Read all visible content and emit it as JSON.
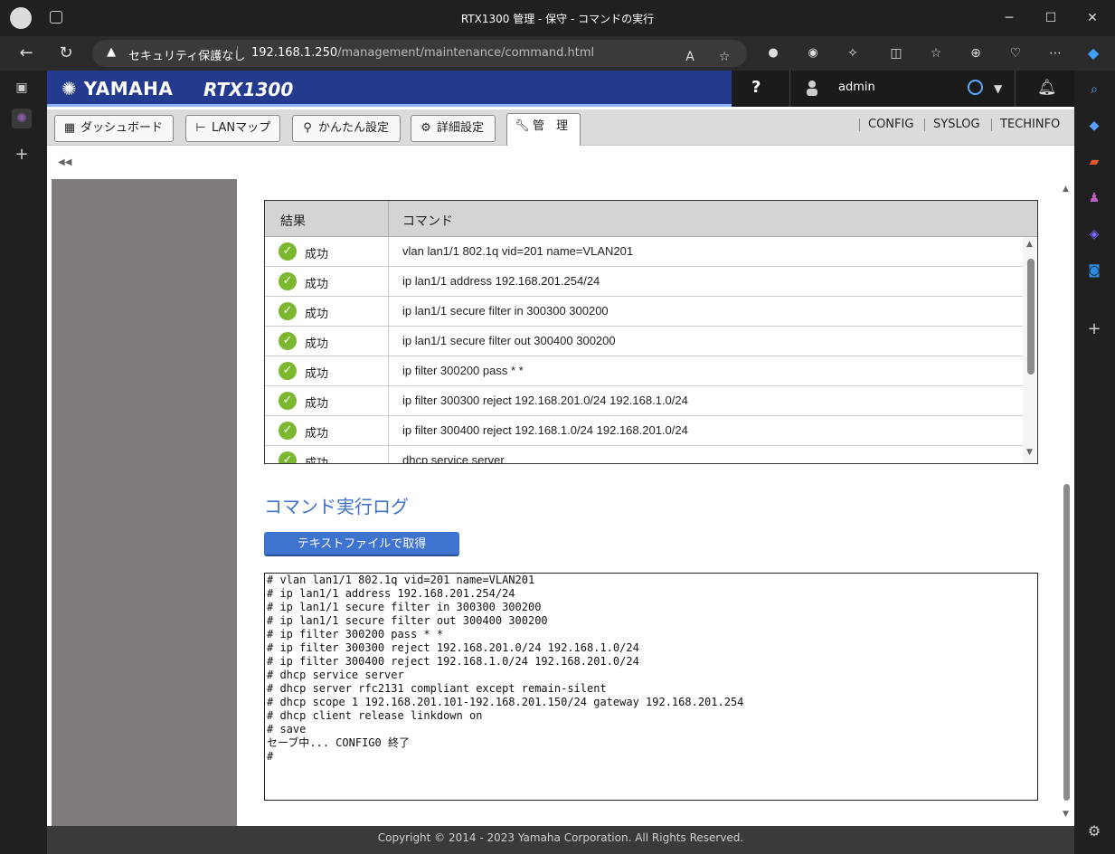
{
  "browser": {
    "title": "RTX1300 管理 - 保守 - コマンドの実行",
    "security_label": "セキュリティ保護なし",
    "url_host": "192.168.1.250",
    "url_path": "/management/maintenance/command.html"
  },
  "header": {
    "logo": "YAMAHA",
    "model": "RTX1300",
    "help": "?",
    "user": "admin"
  },
  "menu": {
    "items": [
      {
        "label": "ダッシュボード",
        "icon": "dashboard-icon"
      },
      {
        "label": "LANマップ",
        "icon": "lanmap-icon"
      },
      {
        "label": "かんたん設定",
        "icon": "wand-icon"
      },
      {
        "label": "詳細設定",
        "icon": "gear-icon"
      },
      {
        "label": "管　理",
        "icon": "wrench-icon"
      }
    ],
    "links": [
      "CONFIG",
      "SYSLOG",
      "TECHINFO"
    ]
  },
  "table": {
    "headers": {
      "result": "結果",
      "command": "コマンド"
    },
    "rows": [
      {
        "result": "成功",
        "command": "vlan lan1/1 802.1q vid=201 name=VLAN201"
      },
      {
        "result": "成功",
        "command": "ip lan1/1 address 192.168.201.254/24"
      },
      {
        "result": "成功",
        "command": "ip lan1/1 secure filter in 300300 300200"
      },
      {
        "result": "成功",
        "command": "ip lan1/1 secure filter out 300400 300200"
      },
      {
        "result": "成功",
        "command": "ip filter 300200 pass * *"
      },
      {
        "result": "成功",
        "command": "ip filter 300300 reject 192.168.201.0/24 192.168.1.0/24"
      },
      {
        "result": "成功",
        "command": "ip filter 300400 reject 192.168.1.0/24 192.168.201.0/24"
      },
      {
        "result": "成功",
        "command": "dhcp service server"
      }
    ]
  },
  "log": {
    "title": "コマンド実行ログ",
    "download_label": "テキストファイルで取得",
    "content": "# vlan lan1/1 802.1q vid=201 name=VLAN201\n# ip lan1/1 address 192.168.201.254/24\n# ip lan1/1 secure filter in 300300 300200\n# ip lan1/1 secure filter out 300400 300200\n# ip filter 300200 pass * *\n# ip filter 300300 reject 192.168.201.0/24 192.168.1.0/24\n# ip filter 300400 reject 192.168.1.0/24 192.168.201.0/24\n# dhcp service server\n# dhcp server rfc2131 compliant except remain-silent\n# dhcp scope 1 192.168.201.101-192.168.201.150/24 gateway 192.168.201.254\n# dhcp client release linkdown on\n# save\nセーブ中... CONFIG0 終了\n#"
  },
  "footer": {
    "copyright": "Copyright © 2014 - 2023 Yamaha Corporation. All Rights Reserved."
  },
  "colors": {
    "header": "#233a8e",
    "accent": "#3e73d0",
    "success": "#7cb82f"
  }
}
